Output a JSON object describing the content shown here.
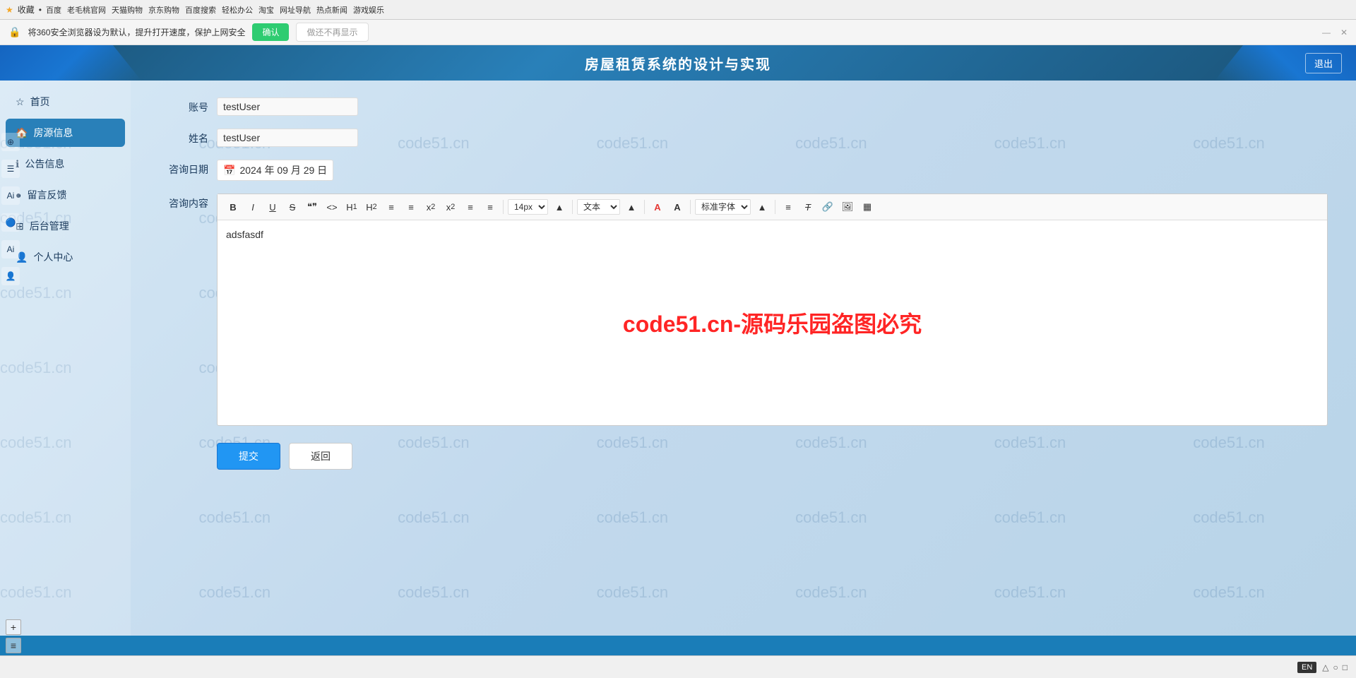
{
  "browser": {
    "nav_items": [
      "收藏",
      "百度",
      "老毛桃官网",
      "天猫购物",
      "京东购物",
      "百度搜索",
      "轻松办公",
      "淘宝",
      "网址导航",
      "热点新闻",
      "游戏娱乐"
    ],
    "security_text": "将360安全浏览器设为默认，提升打开速度，保护上网安全",
    "confirm_btn": "确认",
    "dismiss_btn": "做还不再显示"
  },
  "app": {
    "title": "房屋租赁系统的设计与实现",
    "logout_btn": "退出"
  },
  "sidebar": {
    "items": [
      {
        "id": "home",
        "label": "首页",
        "icon": "☆",
        "active": false
      },
      {
        "id": "house-info",
        "label": "房源信息",
        "icon": "🏠",
        "active": true
      },
      {
        "id": "notice",
        "label": "公告信息",
        "icon": "ℹ",
        "active": false
      },
      {
        "id": "feedback",
        "label": "留言反馈",
        "icon": "●",
        "active": false
      },
      {
        "id": "admin",
        "label": "后台管理",
        "icon": "⊞",
        "active": false
      },
      {
        "id": "profile",
        "label": "个人中心",
        "icon": "👤",
        "active": false
      }
    ]
  },
  "form": {
    "account_label": "账号",
    "account_value": "testUser",
    "name_label": "姓名",
    "name_value": "testUser",
    "date_label": "咨询日期",
    "date_value": "2024 年 09 月 29 日",
    "content_label": "咨询内容",
    "content_text": "adsfasdf",
    "watermark_text": "code51.cn-源码乐园盗图必究"
  },
  "toolbar": {
    "buttons": [
      "B",
      "I",
      "U",
      "S",
      "\"\"",
      "<>",
      "H₁",
      "H₂",
      "≡",
      "≡",
      "x₂",
      "x²",
      "≡",
      "≡"
    ],
    "font_size": "14px",
    "font_size_label": "14px",
    "font_type": "文本",
    "font_family": "标准字体"
  },
  "actions": {
    "submit_label": "提交",
    "back_label": "返回"
  },
  "status_bar": {
    "lang": "EN",
    "icons": [
      "△",
      "○",
      "□"
    ]
  },
  "watermarks": [
    "code51.cn",
    "code51.cn",
    "code51.cn",
    "code51.cn",
    "code51.cn",
    "code51.cn",
    "code51.cn"
  ]
}
